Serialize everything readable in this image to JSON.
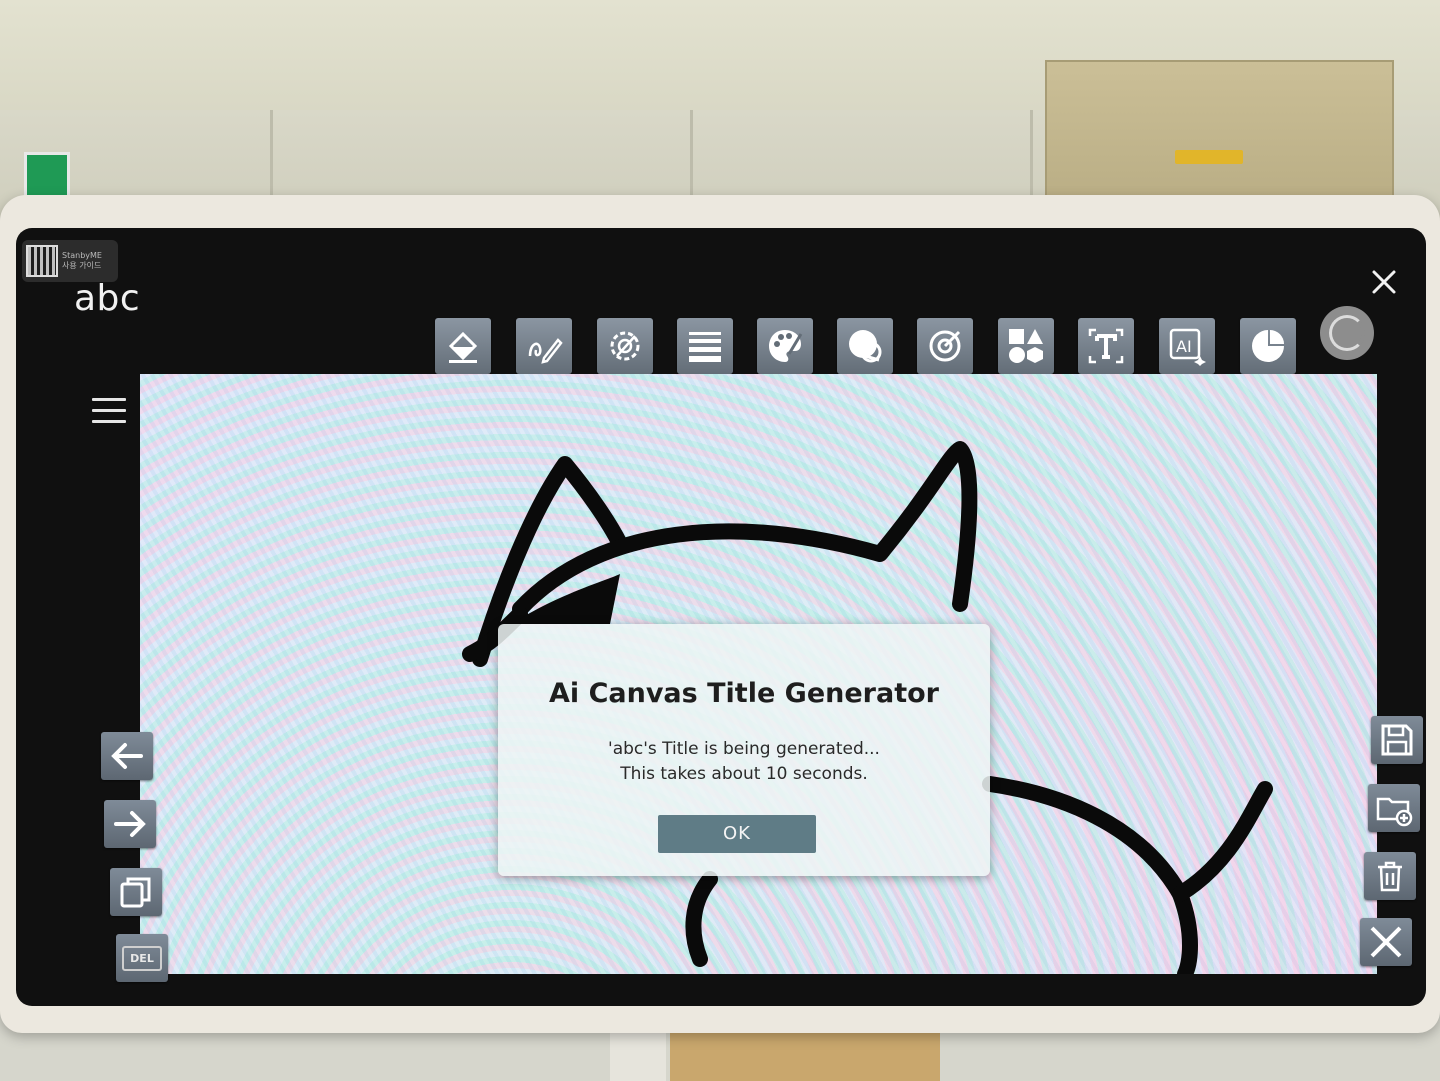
{
  "document": {
    "title": "abc"
  },
  "qr_chip": {
    "line1": "StanbyME",
    "line2": "사용 가이드"
  },
  "toolbar": {
    "tools": [
      {
        "icon": "fill-bucket-icon"
      },
      {
        "icon": "pen-icon"
      },
      {
        "icon": "brush-settings-icon"
      },
      {
        "icon": "lines-icon"
      },
      {
        "icon": "palette-icon"
      },
      {
        "icon": "sticker-icon"
      },
      {
        "icon": "color-picker-icon"
      },
      {
        "icon": "shapes-icon"
      },
      {
        "icon": "text-icon"
      },
      {
        "icon": "ai-icon"
      },
      {
        "icon": "pie-chart-icon"
      },
      {
        "icon": "loading-icon"
      }
    ]
  },
  "left_actions": {
    "del_label": "DEL"
  },
  "dialog": {
    "title": "Ai Canvas Title Generator",
    "message_line1": "'abc's Title is being generated...",
    "message_line2": "This takes about 10 seconds.",
    "ok_label": "OK"
  }
}
